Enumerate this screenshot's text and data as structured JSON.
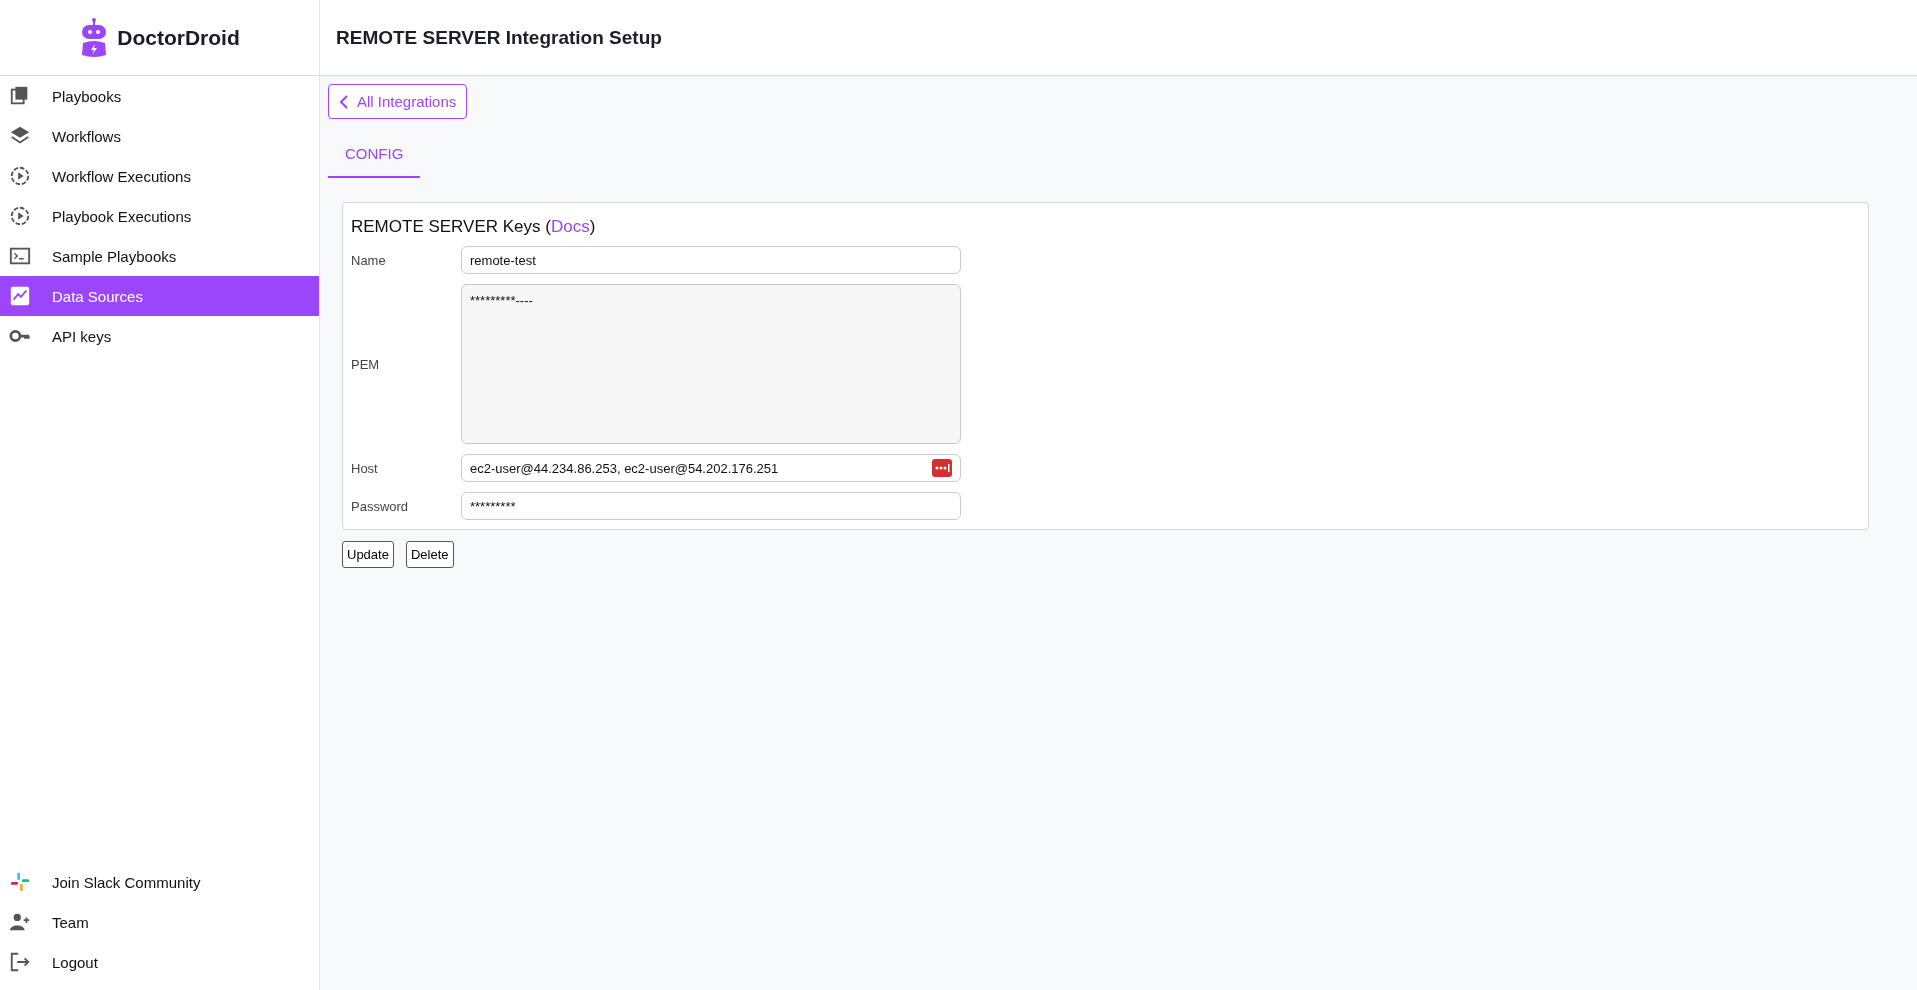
{
  "brand": {
    "name": "DoctorDroid"
  },
  "header": {
    "title": "REMOTE SERVER Integration Setup"
  },
  "sidebar": {
    "items": [
      {
        "label": "Playbooks",
        "kind": "playbooks",
        "selected": false
      },
      {
        "label": "Workflows",
        "kind": "layers",
        "selected": false
      },
      {
        "label": "Workflow Executions",
        "kind": "execution",
        "selected": false
      },
      {
        "label": "Playbook Executions",
        "kind": "execution",
        "selected": false
      },
      {
        "label": "Sample Playbooks",
        "kind": "terminal",
        "selected": false
      },
      {
        "label": "Data Sources",
        "kind": "chart",
        "selected": true
      },
      {
        "label": "API keys",
        "kind": "key",
        "selected": false
      }
    ],
    "footer_items": [
      {
        "label": "Join Slack Community",
        "kind": "slack"
      },
      {
        "label": "Team",
        "kind": "team"
      },
      {
        "label": "Logout",
        "kind": "logout"
      }
    ]
  },
  "back_button": {
    "label": "All Integrations"
  },
  "tabs": [
    {
      "label": "CONFIG",
      "selected": true
    }
  ],
  "card": {
    "title_start": "REMOTE SERVER Keys (",
    "docs_link": "Docs",
    "title_end": ")",
    "fields": [
      {
        "label": "Name",
        "kind": "input",
        "value": "remote-test"
      },
      {
        "label": "PEM",
        "kind": "textarea",
        "value": "*********----"
      },
      {
        "label": "Host",
        "kind": "input_icon",
        "value": "ec2-user@44.234.86.253, ec2-user@54.202.176.251"
      },
      {
        "label": "Password",
        "kind": "input",
        "value": "*********"
      }
    ]
  },
  "buttons": [
    "Update",
    "Delete"
  ]
}
